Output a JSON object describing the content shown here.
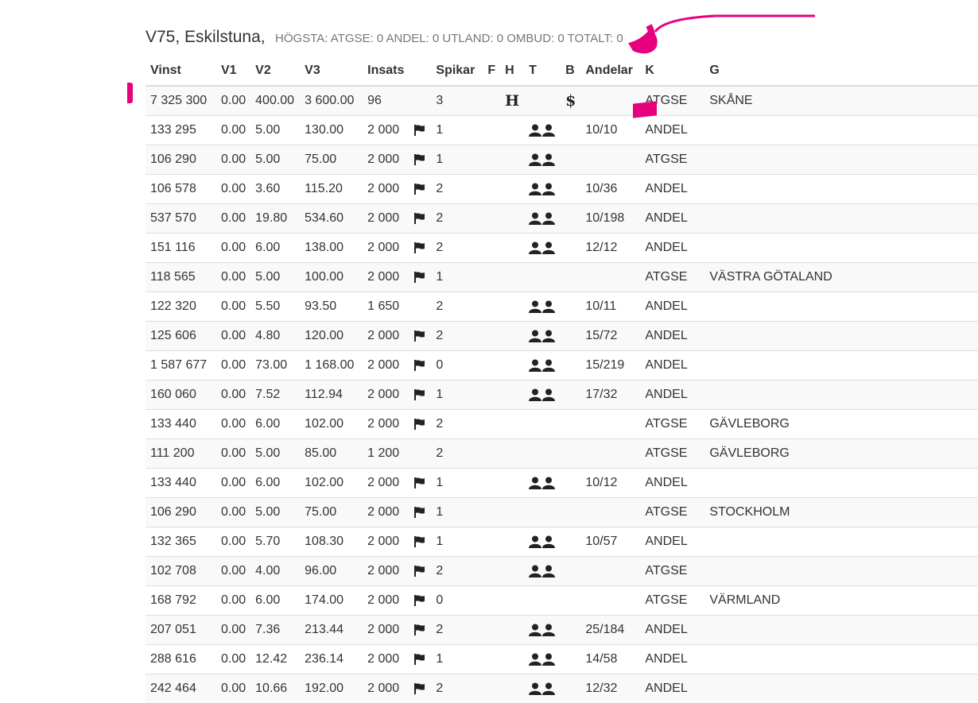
{
  "header": {
    "title": "V75, Eskilstuna,",
    "stats": "HÖGSTA:  ATGSE: 0  ANDEL: 0  UTLAND: 0  OMBUD: 0  TOTALT: 0"
  },
  "columns": [
    "Vinst",
    "V1",
    "V2",
    "V3",
    "Insats",
    "",
    "Spikar",
    "F",
    "H",
    "T",
    "B",
    "Andelar",
    "K",
    "G"
  ],
  "rows": [
    {
      "vinst": "7 325 300",
      "v1": "0.00",
      "v2": "400.00",
      "v3": "3 600.00",
      "insats": "96",
      "flag": false,
      "spikar": "3",
      "f": "",
      "h": "H",
      "t": false,
      "b": "$",
      "andelar": "",
      "k": "ATGSE",
      "g": "SKÅNE"
    },
    {
      "vinst": "133 295",
      "v1": "0.00",
      "v2": "5.00",
      "v3": "130.00",
      "insats": "2 000",
      "flag": true,
      "spikar": "1",
      "f": "",
      "h": "",
      "t": true,
      "b": "",
      "andelar": "10/10",
      "k": "ANDEL",
      "g": ""
    },
    {
      "vinst": "106 290",
      "v1": "0.00",
      "v2": "5.00",
      "v3": "75.00",
      "insats": "2 000",
      "flag": true,
      "spikar": "1",
      "f": "",
      "h": "",
      "t": true,
      "b": "",
      "andelar": "",
      "k": "ATGSE",
      "g": ""
    },
    {
      "vinst": "106 578",
      "v1": "0.00",
      "v2": "3.60",
      "v3": "115.20",
      "insats": "2 000",
      "flag": true,
      "spikar": "2",
      "f": "",
      "h": "",
      "t": true,
      "b": "",
      "andelar": "10/36",
      "k": "ANDEL",
      "g": ""
    },
    {
      "vinst": "537 570",
      "v1": "0.00",
      "v2": "19.80",
      "v3": "534.60",
      "insats": "2 000",
      "flag": true,
      "spikar": "2",
      "f": "",
      "h": "",
      "t": true,
      "b": "",
      "andelar": "10/198",
      "k": "ANDEL",
      "g": ""
    },
    {
      "vinst": "151 116",
      "v1": "0.00",
      "v2": "6.00",
      "v3": "138.00",
      "insats": "2 000",
      "flag": true,
      "spikar": "2",
      "f": "",
      "h": "",
      "t": true,
      "b": "",
      "andelar": "12/12",
      "k": "ANDEL",
      "g": ""
    },
    {
      "vinst": "118 565",
      "v1": "0.00",
      "v2": "5.00",
      "v3": "100.00",
      "insats": "2 000",
      "flag": true,
      "spikar": "1",
      "f": "",
      "h": "",
      "t": false,
      "b": "",
      "andelar": "",
      "k": "ATGSE",
      "g": "VÄSTRA GÖTALAND"
    },
    {
      "vinst": "122 320",
      "v1": "0.00",
      "v2": "5.50",
      "v3": "93.50",
      "insats": "1 650",
      "flag": false,
      "spikar": "2",
      "f": "",
      "h": "",
      "t": true,
      "b": "",
      "andelar": "10/11",
      "k": "ANDEL",
      "g": ""
    },
    {
      "vinst": "125 606",
      "v1": "0.00",
      "v2": "4.80",
      "v3": "120.00",
      "insats": "2 000",
      "flag": true,
      "spikar": "2",
      "f": "",
      "h": "",
      "t": true,
      "b": "",
      "andelar": "15/72",
      "k": "ANDEL",
      "g": ""
    },
    {
      "vinst": "1 587 677",
      "v1": "0.00",
      "v2": "73.00",
      "v3": "1 168.00",
      "insats": "2 000",
      "flag": true,
      "spikar": "0",
      "f": "",
      "h": "",
      "t": true,
      "b": "",
      "andelar": "15/219",
      "k": "ANDEL",
      "g": ""
    },
    {
      "vinst": "160 060",
      "v1": "0.00",
      "v2": "7.52",
      "v3": "112.94",
      "insats": "2 000",
      "flag": true,
      "spikar": "1",
      "f": "",
      "h": "",
      "t": true,
      "b": "",
      "andelar": "17/32",
      "k": "ANDEL",
      "g": ""
    },
    {
      "vinst": "133 440",
      "v1": "0.00",
      "v2": "6.00",
      "v3": "102.00",
      "insats": "2 000",
      "flag": true,
      "spikar": "2",
      "f": "",
      "h": "",
      "t": false,
      "b": "",
      "andelar": "",
      "k": "ATGSE",
      "g": "GÄVLEBORG"
    },
    {
      "vinst": "111 200",
      "v1": "0.00",
      "v2": "5.00",
      "v3": "85.00",
      "insats": "1 200",
      "flag": false,
      "spikar": "2",
      "f": "",
      "h": "",
      "t": false,
      "b": "",
      "andelar": "",
      "k": "ATGSE",
      "g": "GÄVLEBORG"
    },
    {
      "vinst": "133 440",
      "v1": "0.00",
      "v2": "6.00",
      "v3": "102.00",
      "insats": "2 000",
      "flag": true,
      "spikar": "1",
      "f": "",
      "h": "",
      "t": true,
      "b": "",
      "andelar": "10/12",
      "k": "ANDEL",
      "g": ""
    },
    {
      "vinst": "106 290",
      "v1": "0.00",
      "v2": "5.00",
      "v3": "75.00",
      "insats": "2 000",
      "flag": true,
      "spikar": "1",
      "f": "",
      "h": "",
      "t": false,
      "b": "",
      "andelar": "",
      "k": "ATGSE",
      "g": "STOCKHOLM"
    },
    {
      "vinst": "132 365",
      "v1": "0.00",
      "v2": "5.70",
      "v3": "108.30",
      "insats": "2 000",
      "flag": true,
      "spikar": "1",
      "f": "",
      "h": "",
      "t": true,
      "b": "",
      "andelar": "10/57",
      "k": "ANDEL",
      "g": ""
    },
    {
      "vinst": "102 708",
      "v1": "0.00",
      "v2": "4.00",
      "v3": "96.00",
      "insats": "2 000",
      "flag": true,
      "spikar": "2",
      "f": "",
      "h": "",
      "t": true,
      "b": "",
      "andelar": "",
      "k": "ATGSE",
      "g": ""
    },
    {
      "vinst": "168 792",
      "v1": "0.00",
      "v2": "6.00",
      "v3": "174.00",
      "insats": "2 000",
      "flag": true,
      "spikar": "0",
      "f": "",
      "h": "",
      "t": false,
      "b": "",
      "andelar": "",
      "k": "ATGSE",
      "g": "VÄRMLAND"
    },
    {
      "vinst": "207 051",
      "v1": "0.00",
      "v2": "7.36",
      "v3": "213.44",
      "insats": "2 000",
      "flag": true,
      "spikar": "2",
      "f": "",
      "h": "",
      "t": true,
      "b": "",
      "andelar": "25/184",
      "k": "ANDEL",
      "g": ""
    },
    {
      "vinst": "288 616",
      "v1": "0.00",
      "v2": "12.42",
      "v3": "236.14",
      "insats": "2 000",
      "flag": true,
      "spikar": "1",
      "f": "",
      "h": "",
      "t": true,
      "b": "",
      "andelar": "14/58",
      "k": "ANDEL",
      "g": ""
    },
    {
      "vinst": "242 464",
      "v1": "0.00",
      "v2": "10.66",
      "v3": "192.00",
      "insats": "2 000",
      "flag": true,
      "spikar": "2",
      "f": "",
      "h": "",
      "t": true,
      "b": "",
      "andelar": "12/32",
      "k": "ANDEL",
      "g": ""
    }
  ],
  "icons": {
    "flag": "flag-icon",
    "group": "group-icon"
  },
  "colors": {
    "annotation": "#e6007e",
    "row_stripe": "#f9f9f9",
    "border": "#dddddd"
  }
}
